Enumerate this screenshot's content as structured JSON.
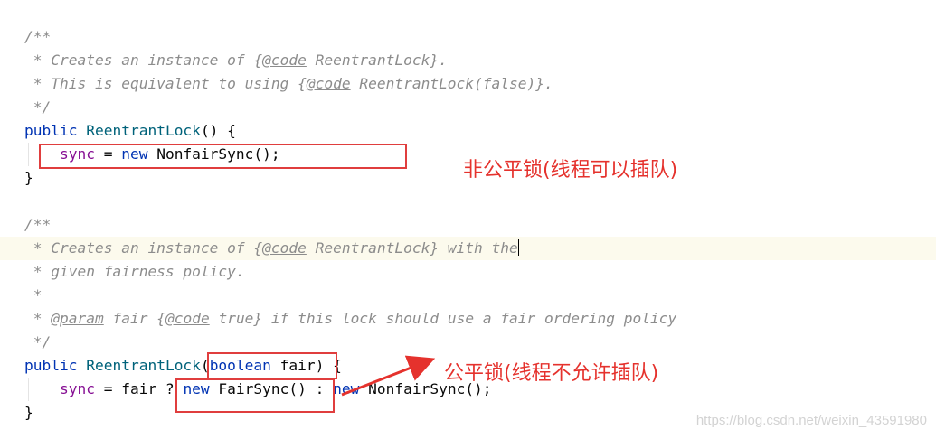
{
  "editor": {
    "lines": [
      [
        {
          "t": "/**",
          "c": "cmt"
        }
      ],
      [
        {
          "t": " * Creates an instance of {",
          "c": "cmt"
        },
        {
          "t": "@code",
          "c": "tag"
        },
        {
          "t": " ReentrantLock}.",
          "c": "cmt"
        }
      ],
      [
        {
          "t": " * This is equivalent to using {",
          "c": "cmt"
        },
        {
          "t": "@code",
          "c": "tag"
        },
        {
          "t": " ReentrantLock(false)}.",
          "c": "cmt"
        }
      ],
      [
        {
          "t": " */",
          "c": "cmt"
        }
      ],
      [
        {
          "t": "public ",
          "c": "kw"
        },
        {
          "t": "ReentrantLock",
          "c": "fn"
        },
        {
          "t": "() {",
          "c": "plain"
        }
      ],
      [
        {
          "t": "    ",
          "c": "plain"
        },
        {
          "t": "sync",
          "c": "fld"
        },
        {
          "t": " = ",
          "c": "plain"
        },
        {
          "t": "new ",
          "c": "kw"
        },
        {
          "t": "NonfairSync();",
          "c": "plain"
        }
      ],
      [
        {
          "t": "}",
          "c": "plain"
        }
      ],
      [],
      [
        {
          "t": "/**",
          "c": "cmt"
        }
      ],
      [
        {
          "t": " * Creates an instance of {",
          "c": "cmt"
        },
        {
          "t": "@code",
          "c": "tag"
        },
        {
          "t": " ReentrantLock} with the",
          "c": "cmt"
        }
      ],
      [
        {
          "t": " * given fairness policy.",
          "c": "cmt"
        }
      ],
      [
        {
          "t": " *",
          "c": "cmt"
        }
      ],
      [
        {
          "t": " * ",
          "c": "cmt"
        },
        {
          "t": "@param",
          "c": "tag"
        },
        {
          "t": " fair {",
          "c": "cmt"
        },
        {
          "t": "@code",
          "c": "tag"
        },
        {
          "t": " true} if this lock should use a fair ordering policy",
          "c": "cmt"
        }
      ],
      [
        {
          "t": " */",
          "c": "cmt"
        }
      ],
      [
        {
          "t": "public ",
          "c": "kw"
        },
        {
          "t": "ReentrantLock",
          "c": "fn"
        },
        {
          "t": "(",
          "c": "plain"
        },
        {
          "t": "boolean ",
          "c": "kw"
        },
        {
          "t": "fair) {",
          "c": "plain"
        }
      ],
      [
        {
          "t": "    ",
          "c": "plain"
        },
        {
          "t": "sync",
          "c": "fld"
        },
        {
          "t": " = fair ? ",
          "c": "plain"
        },
        {
          "t": "new ",
          "c": "kw"
        },
        {
          "t": "FairSync() : ",
          "c": "plain"
        },
        {
          "t": "new ",
          "c": "kw"
        },
        {
          "t": "NonfairSync();",
          "c": "plain"
        }
      ],
      [
        {
          "t": "}",
          "c": "plain"
        }
      ]
    ]
  },
  "annotations": {
    "nonfair": "非公平锁(线程可以插队)",
    "fair": "公平锁(线程不允许插队)"
  },
  "watermark": "https://blog.csdn.net/weixin_43591980",
  "colors": {
    "annotation_red": "#e5322d",
    "box_red": "#e03e3e",
    "keyword": "#0033b3",
    "method": "#00627a",
    "field": "#871094",
    "comment": "#8c8c8c"
  }
}
